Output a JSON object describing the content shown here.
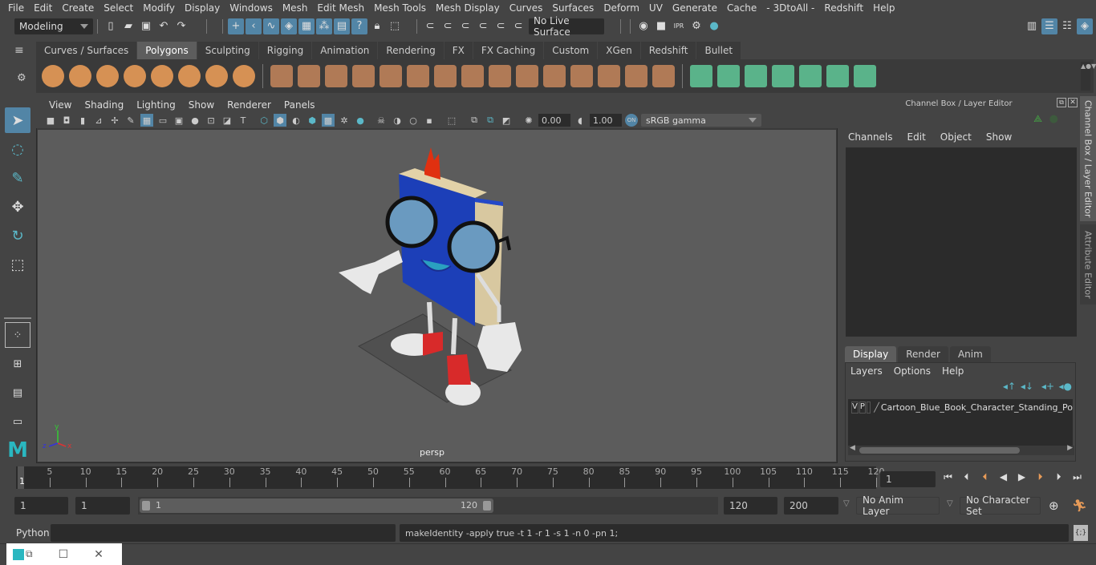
{
  "menubar": [
    "File",
    "Edit",
    "Create",
    "Select",
    "Modify",
    "Display",
    "Windows",
    "Mesh",
    "Edit Mesh",
    "Mesh Tools",
    "Mesh Display",
    "Curves",
    "Surfaces",
    "Deform",
    "UV",
    "Generate",
    "Cache",
    "- 3DtoAll -",
    "Redshift",
    "Help"
  ],
  "status_line": {
    "workspace": "Modeling",
    "live_surface": "No Live Surface"
  },
  "shelf": {
    "tabs": [
      "Curves / Surfaces",
      "Polygons",
      "Sculpting",
      "Rigging",
      "Animation",
      "Rendering",
      "FX",
      "FX Caching",
      "Custom",
      "XGen",
      "Redshift",
      "Bullet"
    ],
    "active_tab": "Polygons",
    "primitive_icons": [
      "poly-sphere-icon",
      "poly-cube-icon",
      "poly-cylinder-icon",
      "poly-cone-icon",
      "poly-diamond-icon",
      "poly-torus-icon",
      "poly-pyramid-icon",
      "poly-pipe-icon"
    ],
    "edit_icons": [
      "combine-icon",
      "separate-icon",
      "mirror-icon",
      "smooth-icon",
      "bevel-icon",
      "extrude-icon",
      "bridge-icon",
      "insert-edgeloop-icon",
      "multicut-icon",
      "fill-hole-icon",
      "target-weld-icon",
      "boolean-icon",
      "sculpt-icon",
      "quad-draw-icon",
      "uv-icon"
    ],
    "uv_icons": [
      "planar-uv-icon",
      "cylindrical-uv-icon",
      "spherical-uv-icon",
      "automatic-uv-icon",
      "unfold-icon",
      "uv-editor-icon",
      "cut-sew-icon"
    ]
  },
  "viewport": {
    "menu": [
      "View",
      "Shading",
      "Lighting",
      "Show",
      "Renderer",
      "Panels"
    ],
    "exposure": "0.00",
    "gamma": "1.00",
    "color_space": "sRGB gamma",
    "camera_label": "persp"
  },
  "channel_box": {
    "title": "Channel Box / Layer Editor",
    "menu": [
      "Channels",
      "Edit",
      "Object",
      "Show"
    ],
    "layer_tabs": [
      "Display",
      "Render",
      "Anim"
    ],
    "active_layer_tab": "Display",
    "layer_menu": [
      "Layers",
      "Options",
      "Help"
    ],
    "layers": [
      {
        "v": "V",
        "p": "P",
        "name": "Cartoon_Blue_Book_Character_Standing_Po"
      }
    ]
  },
  "side_tabs": [
    "Channel Box / Layer Editor",
    "Attribute Editor"
  ],
  "timeline": {
    "ticks": [
      5,
      10,
      15,
      20,
      25,
      30,
      35,
      40,
      45,
      50,
      55,
      60,
      65,
      70,
      75,
      80,
      85,
      90,
      95,
      100,
      105,
      110,
      115,
      120
    ],
    "start": 1,
    "end": 120,
    "current_frame": "1",
    "current_frame_field": "1"
  },
  "range": {
    "start_field": "1",
    "playback_start": "1",
    "slider_min": "1",
    "slider_max": "120",
    "playback_end": "120",
    "end_field": "200",
    "anim_layer": "No Anim Layer",
    "character_set": "No Character Set"
  },
  "command_line": {
    "language": "Python",
    "input": "",
    "result": "makeIdentity -apply true -t 1 -r 1 -s 1 -n 0 -pn 1;"
  }
}
